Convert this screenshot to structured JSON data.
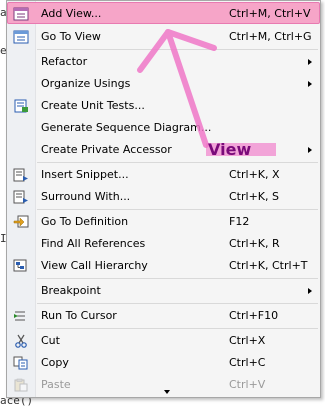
{
  "background_text": {
    "line1": "a",
    "line2": "e",
    "line3": "I",
    "line4": "ace()"
  },
  "menu": {
    "items": [
      {
        "label": "Add View...",
        "shortcut": "Ctrl+M, Ctrl+V",
        "icon": "add-view-icon"
      },
      {
        "label": "Go To View",
        "shortcut": "Ctrl+M, Ctrl+G",
        "icon": "go-to-view-icon"
      },
      {
        "label": "Refactor",
        "shortcut": ""
      },
      {
        "label": "Organize Usings",
        "shortcut": ""
      },
      {
        "label": "Create Unit Tests...",
        "shortcut": "",
        "icon": "unit-tests-icon"
      },
      {
        "label": "Generate Sequence Diagram...",
        "shortcut": ""
      },
      {
        "label": "Create Private Accessor",
        "shortcut": ""
      },
      {
        "label": "Insert Snippet...",
        "shortcut": "Ctrl+K, X",
        "icon": "insert-snippet-icon"
      },
      {
        "label": "Surround With...",
        "shortcut": "Ctrl+K, S",
        "icon": "surround-with-icon"
      },
      {
        "label": "Go To Definition",
        "shortcut": "F12",
        "icon": "go-to-definition-icon"
      },
      {
        "label": "Find All References",
        "shortcut": "Ctrl+K, R"
      },
      {
        "label": "View Call Hierarchy",
        "shortcut": "Ctrl+K, Ctrl+T",
        "icon": "call-hierarchy-icon"
      },
      {
        "label": "Breakpoint",
        "shortcut": ""
      },
      {
        "label": "Run To Cursor",
        "shortcut": "Ctrl+F10",
        "icon": "run-to-cursor-icon"
      },
      {
        "label": "Cut",
        "shortcut": "Ctrl+X",
        "icon": "scissors-icon"
      },
      {
        "label": "Copy",
        "shortcut": "Ctrl+C",
        "icon": "copy-icon"
      },
      {
        "label": "Paste",
        "shortcut": "Ctrl+V",
        "icon": "paste-icon",
        "disabled": true
      }
    ]
  },
  "annotation": {
    "label": "View",
    "color": "#f078c8"
  }
}
